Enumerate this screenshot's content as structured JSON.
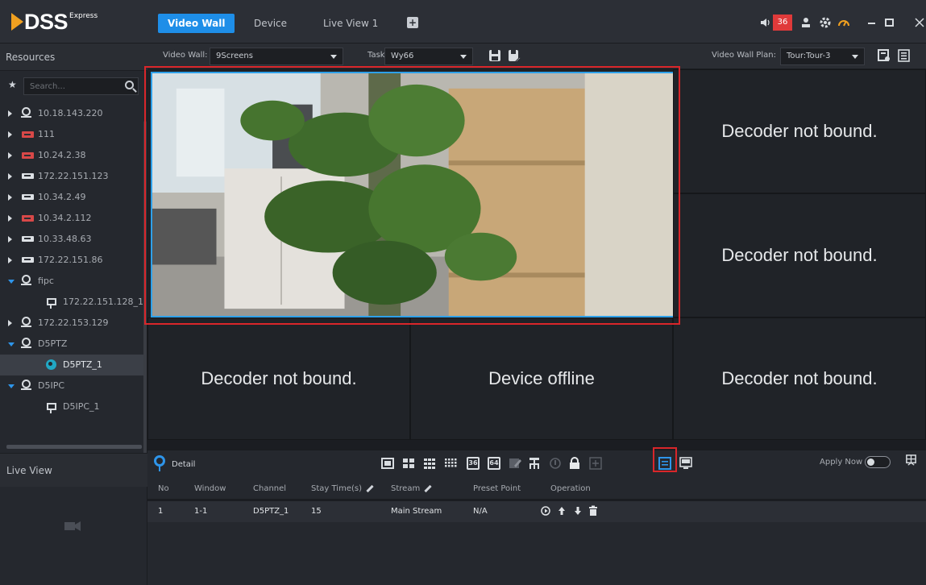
{
  "app": {
    "logo_name": "DSS",
    "logo_edition": "Express"
  },
  "tabs": [
    {
      "label": "Video Wall",
      "active": true
    },
    {
      "label": "Device",
      "active": false
    },
    {
      "label": "Live View 1",
      "active": false
    }
  ],
  "header": {
    "alarm_count": "36"
  },
  "sidebar": {
    "resources_title": "Resources",
    "search_placeholder": "Search...",
    "tree": [
      {
        "label": "10.18.143.220",
        "icon": "encoder-icon",
        "expand": "collapsed",
        "level": 0
      },
      {
        "label": "111",
        "icon": "dvr-icon",
        "expand": "collapsed",
        "level": 0
      },
      {
        "label": "10.24.2.38",
        "icon": "dvr-icon",
        "expand": "collapsed",
        "level": 0
      },
      {
        "label": "172.22.151.123",
        "icon": "nvr-icon",
        "expand": "collapsed",
        "level": 0
      },
      {
        "label": "10.34.2.49",
        "icon": "nvr-icon",
        "expand": "collapsed",
        "level": 0
      },
      {
        "label": "10.34.2.112",
        "icon": "dvr-icon",
        "expand": "collapsed",
        "level": 0
      },
      {
        "label": "10.33.48.63",
        "icon": "nvr-icon",
        "expand": "collapsed",
        "level": 0
      },
      {
        "label": "172.22.151.86",
        "icon": "nvr-icon",
        "expand": "collapsed",
        "level": 0
      },
      {
        "label": "fipc",
        "icon": "encoder-icon",
        "expand": "expanded",
        "level": 0
      },
      {
        "label": "172.22.151.128_1",
        "icon": "ipc-icon",
        "expand": "none",
        "level": 1
      },
      {
        "label": "172.22.153.129",
        "icon": "encoder-icon",
        "expand": "collapsed",
        "level": 0
      },
      {
        "label": "D5PTZ",
        "icon": "encoder-icon",
        "expand": "expanded",
        "level": 0
      },
      {
        "label": "D5PTZ_1",
        "icon": "ptz-icon",
        "expand": "none",
        "level": 1,
        "selected": true
      },
      {
        "label": "D5IPC",
        "icon": "encoder-icon",
        "expand": "expanded",
        "level": 0
      },
      {
        "label": "D5IPC_1",
        "icon": "ipc-icon",
        "expand": "none",
        "level": 1
      }
    ],
    "live_view_title": "Live View"
  },
  "wall_toolbar": {
    "video_wall_label": "Video Wall:",
    "video_wall_value": "9Screens",
    "task_label": "Task:",
    "task_value": "Wy66",
    "plan_label": "Video Wall Plan:",
    "plan_value": "Tour:Tour-3"
  },
  "cells": {
    "r0c2": "Decoder not bound.",
    "r1c2": "Decoder not bound.",
    "r2c0": "Decoder not bound.",
    "r2c1": "Device offline",
    "r2c2": "Decoder not bound."
  },
  "detail": {
    "title": "Detail",
    "layout_36": "36",
    "layout_64": "64",
    "apply_now": "Apply Now",
    "columns": [
      "No",
      "Window",
      "Channel",
      "Stay Time(s)",
      "Stream",
      "Preset Point",
      "Operation"
    ],
    "rows": [
      {
        "no": "1",
        "window": "1-1",
        "channel": "D5PTZ_1",
        "stay": "15",
        "stream": "Main Stream",
        "preset": "N/A"
      }
    ]
  },
  "colors": {
    "accent": "#1e8ee8",
    "alarm": "#e03a3a",
    "highlight": "#d9262a",
    "video_border": "#2ea1ea"
  }
}
